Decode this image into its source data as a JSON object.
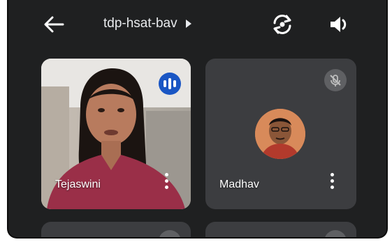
{
  "topbar": {
    "meeting_code": "tdp-hsat-bav"
  },
  "participants": [
    {
      "name": "Tejaswini",
      "speaking": true,
      "muted": false
    },
    {
      "name": "Madhav",
      "speaking": false,
      "muted": true
    }
  ],
  "icons": {
    "back": "arrow-left-icon",
    "switch_camera": "switch-camera-icon",
    "speaker": "speaker-icon",
    "speaking": "audio-wave-icon",
    "muted": "mic-off-icon",
    "more": "more-vert-icon"
  },
  "colors": {
    "background": "#1f2021",
    "tile": "#3c3d40",
    "speaking_badge": "#1a56c4",
    "muted_badge": "#5f6063"
  }
}
